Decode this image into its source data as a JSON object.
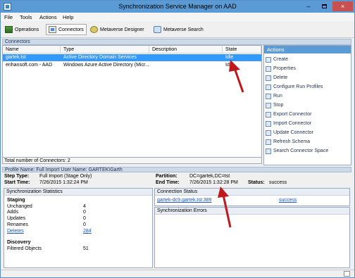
{
  "window": {
    "title": "Synchronization Service Manager on AAD",
    "close_label": "×",
    "minimize_label": "–"
  },
  "menu": [
    "File",
    "Tools",
    "Actions",
    "Help"
  ],
  "toolbar": {
    "operations": "Operations",
    "connectors": "Connectors",
    "metaverse_designer": "Metaverse Designer",
    "metaverse_search": "Metaverse Search"
  },
  "connectors": {
    "section_title": "Connectors",
    "columns": [
      "Name",
      "Type",
      "Description",
      "State"
    ],
    "rows": [
      {
        "name": "gartek.tst",
        "type": "Active Directory Domain Services",
        "description": "",
        "state": "Idle"
      },
      {
        "name": "enhansoft.com - AAD",
        "type": "Windows Azure Active Directory (Micr...",
        "description": "",
        "state": "Idle"
      }
    ],
    "total": "Total number of Connectors: 2"
  },
  "actions": {
    "title": "Actions",
    "items": [
      "Create",
      "Properties",
      "Delete",
      "Configure Run Profiles",
      "Run",
      "Stop",
      "Export Connector",
      "Import Connector",
      "Update Connector",
      "Refresh Schema",
      "Search Connector Space"
    ]
  },
  "profile": {
    "band": "Profile Name: Full Import  User Name: GARTEK\\Garth",
    "step_type_label": "Step Type:",
    "step_type": "Full Import (Stage Only)",
    "start_time_label": "Start Time:",
    "start_time": "7/26/2015 1:32:24 PM",
    "partition_label": "Partition:",
    "partition": "DC=gartek,DC=tst",
    "end_time_label": "End Time:",
    "end_time": "7/26/2015 1:32:28 PM",
    "status_label": "Status:",
    "status": "success"
  },
  "sync_stats": {
    "title": "Synchronization Statistics",
    "staging_label": "Staging",
    "unchanged_label": "Unchanged",
    "unchanged": "4",
    "adds_label": "Adds",
    "adds": "0",
    "updates_label": "Updates",
    "updates": "0",
    "renames_label": "Renames",
    "renames": "0",
    "deletes_label": "Deletes",
    "deletes": "284",
    "discovery_label": "Discovery",
    "filtered_label": "Filtered Objects",
    "filtered": "51"
  },
  "connection_status": {
    "title": "Connection Status",
    "server": "gartek-dc9.gartek.tst:389",
    "result": "success"
  },
  "sync_errors": {
    "title": "Synchronization Errors"
  },
  "colors": {
    "titlebar": "#5b9bd5",
    "selected_row": "#3399ff",
    "arrow": "#c0181c",
    "close": "#c75050"
  }
}
